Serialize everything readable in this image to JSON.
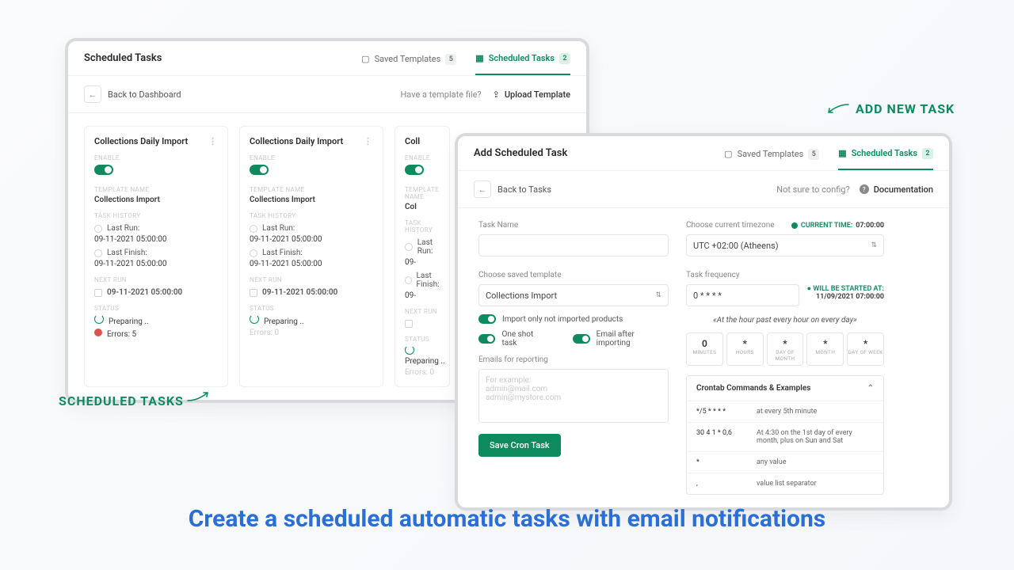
{
  "annotations": {
    "scheduled_tasks": "SCHEDULED TASKS",
    "add_new_task": "ADD NEW TASK",
    "headline": "Create a scheduled automatic tasks with email notifications"
  },
  "left": {
    "title": "Scheduled Tasks",
    "tabs": {
      "saved": "Saved Templates",
      "saved_count": "5",
      "scheduled": "Scheduled Tasks",
      "scheduled_count": "2"
    },
    "back": "Back to Dashboard",
    "have_file": "Have a template file?",
    "upload": "Upload Template",
    "labels": {
      "enable": "ENABLE",
      "template_name": "TEMPLATE NAME",
      "task_history": "TASK HISTORY",
      "next_run": "NEXT RUN",
      "status": "STATUS",
      "last_run": "Last Run:",
      "last_finish": "Last Finish:",
      "preparing": "Preparing ..",
      "errors": "Errors: 5",
      "errors0": "Errors: 0"
    },
    "cards": [
      {
        "title": "Collections Daily Import",
        "template": "Collections Import",
        "last_run": "09-11-2021 05:00:00",
        "last_finish": "09-11-2021 05:00:00",
        "next": "09-11-2021 05:00:00",
        "has_errors": true
      },
      {
        "title": "Collections Daily Import",
        "template": "Collections Import",
        "last_run": "09-11-2021 05:00:00",
        "last_finish": "09-11-2021 05:00:00",
        "next": "09-11-2021 05:00:00",
        "has_errors": false
      },
      {
        "title": "Coll",
        "template": "Col",
        "last_run": "09-",
        "last_finish": "09-",
        "next": "",
        "has_errors": false
      }
    ]
  },
  "right": {
    "title": "Add Scheduled Task",
    "tabs": {
      "saved": "Saved Templates",
      "saved_count": "5",
      "scheduled": "Scheduled Tasks",
      "scheduled_count": "2"
    },
    "back": "Back to Tasks",
    "not_sure": "Not sure to config?",
    "docs": "Documentation",
    "form": {
      "task_name_label": "Task Name",
      "tz_label": "Choose current timezone",
      "current_time_label": "CURRENT TIME:",
      "current_time": "07:00:00",
      "tz_value": "UTC +02:00 (Atheens)",
      "saved_template_label": "Choose saved template",
      "saved_template_value": "Collections Import",
      "freq_label": "Task frequency",
      "freq_value": "0 * * * *",
      "start_label": "WILL BE STARTED AT:",
      "start_value": "11/09/2021 07:00:00",
      "readable": "«At the hour past every hour on every day»",
      "import_only": "Import only not imported products",
      "one_shot": "One shot task",
      "email_after": "Email after importing",
      "emails_label": "Emails for reporting",
      "emails_placeholder": "For example:\nadmin@mail.com\nadmin@mystore.com",
      "save": "Save Cron Task",
      "parts": [
        {
          "v": "0",
          "n": "MINUTES"
        },
        {
          "v": "*",
          "n": "HOURS"
        },
        {
          "v": "*",
          "n": "DAY OF MONTH"
        },
        {
          "v": "*",
          "n": "MONTH"
        },
        {
          "v": "*",
          "n": "DAY OF WEEK"
        }
      ],
      "examples_title": "Crontab Commands & Examples",
      "examples": [
        {
          "c": "*/5 * * * *",
          "d": "at every 5th minute"
        },
        {
          "c": "30 4 1 * 0,6",
          "d": "At 4:30 on the 1st day of every month, plus on Sun and Sat"
        },
        {
          "c": "*",
          "d": "any value"
        },
        {
          "c": ",",
          "d": "value list separator"
        }
      ]
    }
  }
}
